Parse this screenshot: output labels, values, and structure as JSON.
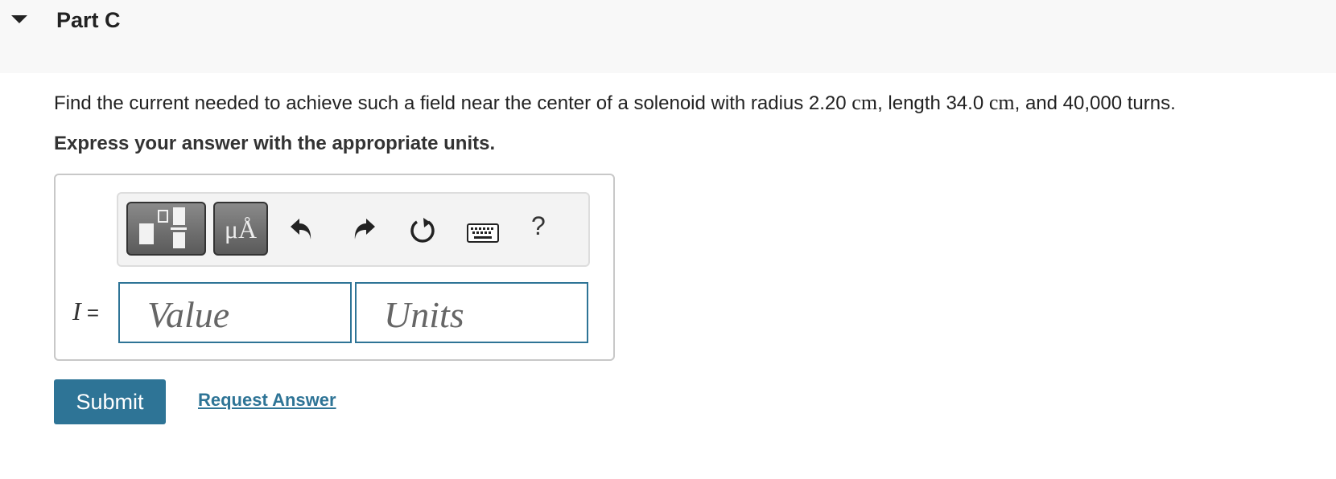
{
  "part": {
    "title": "Part C"
  },
  "question": {
    "text_1": "Find the current needed to achieve such a field near the center of a solenoid with radius 2.20 ",
    "unit_1": "cm",
    "text_2": ", length 34.0 ",
    "unit_2": "cm",
    "text_3": ", and 40,000 turns."
  },
  "instruction": "Express your answer with the appropriate units.",
  "toolbar": {
    "templates_icon": "templates-icon",
    "units_label": "μÅ",
    "undo_icon": "undo-icon",
    "redo_icon": "redo-icon",
    "reset_icon": "reset-icon",
    "keyboard_icon": "keyboard-icon",
    "help_label": "?"
  },
  "answer": {
    "variable": "I",
    "equals": "=",
    "value_placeholder": "Value",
    "units_placeholder": "Units"
  },
  "actions": {
    "submit_label": "Submit",
    "request_label": "Request Answer"
  },
  "colors": {
    "accent": "#2e7496",
    "header_bg": "#f8f8f8"
  }
}
